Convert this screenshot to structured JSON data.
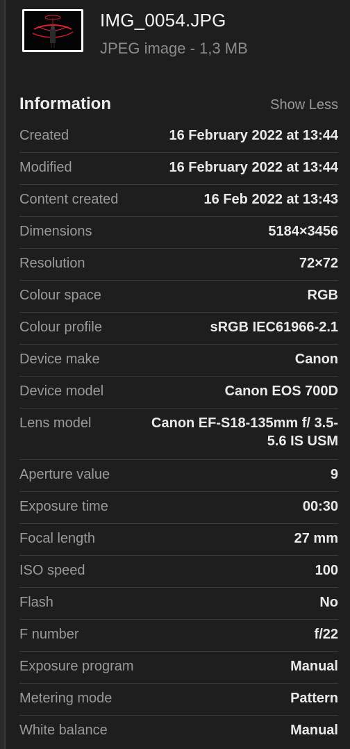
{
  "file": {
    "name": "IMG_0054.JPG",
    "subtitle": "JPEG image - 1,3 MB"
  },
  "info": {
    "title": "Information",
    "toggle_label": "Show Less",
    "rows": [
      {
        "label": "Created",
        "value": "16 February 2022 at 13:44"
      },
      {
        "label": "Modified",
        "value": "16 February 2022 at 13:44"
      },
      {
        "label": "Content created",
        "value": "16 Feb 2022 at 13:43"
      },
      {
        "label": "Dimensions",
        "value": "5184×3456"
      },
      {
        "label": "Resolution",
        "value": "72×72"
      },
      {
        "label": "Colour space",
        "value": "RGB"
      },
      {
        "label": "Colour profile",
        "value": "sRGB IEC61966-2.1"
      },
      {
        "label": "Device make",
        "value": "Canon"
      },
      {
        "label": "Device model",
        "value": "Canon EOS 700D"
      },
      {
        "label": "Lens model",
        "value": "Canon EF-S18-135mm f/ 3.5-5.6 IS USM"
      },
      {
        "label": "Aperture value",
        "value": "9"
      },
      {
        "label": "Exposure time",
        "value": "00:30"
      },
      {
        "label": "Focal length",
        "value": "27 mm"
      },
      {
        "label": "ISO speed",
        "value": "100"
      },
      {
        "label": "Flash",
        "value": "No"
      },
      {
        "label": "F number",
        "value": "f/22"
      },
      {
        "label": "Exposure program",
        "value": "Manual"
      },
      {
        "label": "Metering mode",
        "value": "Pattern"
      },
      {
        "label": "White balance",
        "value": "Manual"
      }
    ]
  },
  "colors": {
    "background": "#1e1e1e",
    "label": "#9a9a9a",
    "value": "#e9e9e9",
    "divider": "#3a3a3a"
  }
}
